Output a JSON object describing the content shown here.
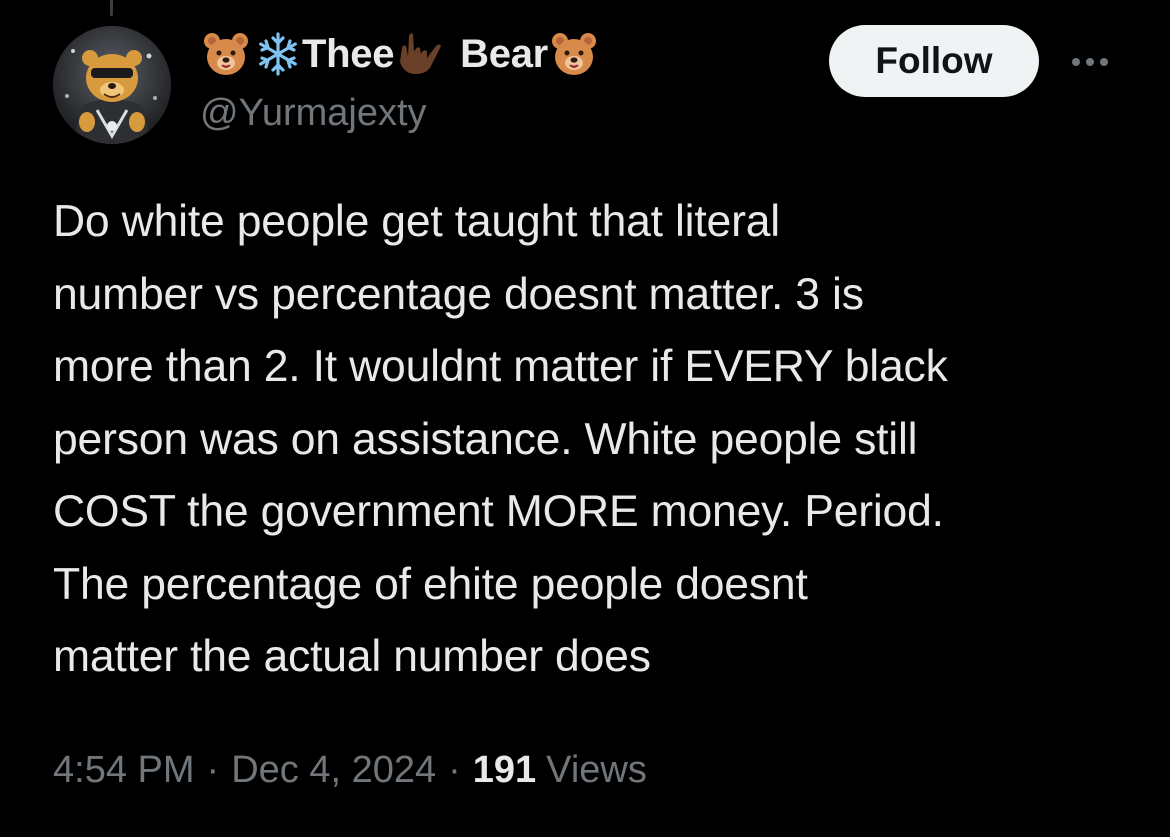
{
  "author": {
    "display_name_part1": "Thee",
    "display_name_part2": "Bear",
    "handle": "@Yurmajexty",
    "name_emojis": [
      "bear-face-icon",
      "snowflake-icon",
      "love-you-gesture-icon",
      "bear-face-icon"
    ]
  },
  "actions": {
    "follow_label": "Follow"
  },
  "tweet": {
    "text_lines": [
      "Do white people get taught that literal",
      "number vs percentage doesnt matter. 3 is",
      "more than 2. It wouldnt matter if EVERY black",
      "person was on assistance. White people still",
      "COST the government MORE money. Period.",
      "The percentage of ehite people doesnt",
      "matter the actual number does"
    ]
  },
  "meta": {
    "time": "4:54 PM",
    "date": "Dec 4, 2024",
    "separator": "·",
    "views_count": "191",
    "views_label": "Views"
  },
  "colors": {
    "background": "#000000",
    "primary_text": "#e7e9ea",
    "secondary_text": "#71767b",
    "follow_bg": "#eff3f4",
    "follow_text": "#0f1419",
    "bear": "#d88a4a",
    "snowflake": "#7fc4f0",
    "hand": "#6b4028"
  }
}
